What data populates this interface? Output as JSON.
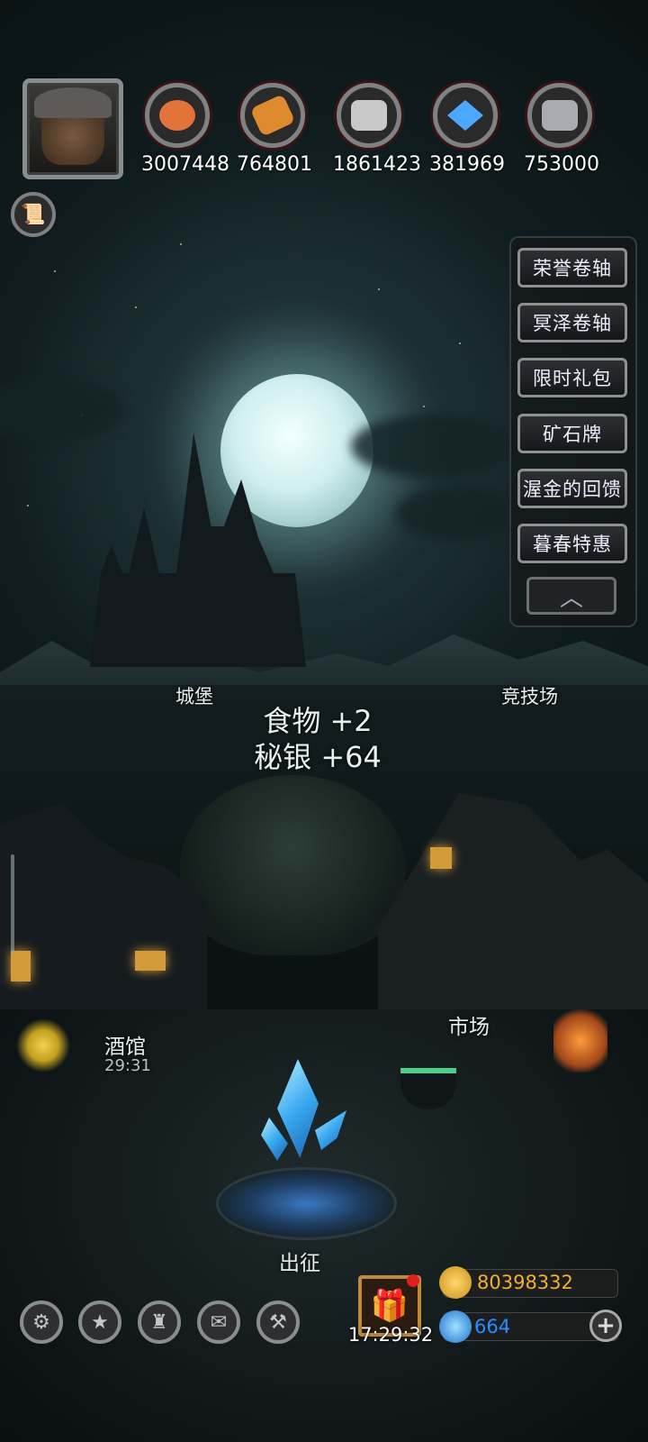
{
  "resources": [
    {
      "icon": "meat-icon",
      "value": "3007448",
      "color": "#e2733a"
    },
    {
      "icon": "wood-planks-icon",
      "value": "764801",
      "color": "#e08a30"
    },
    {
      "icon": "stone-bricks-icon",
      "value": "1861423",
      "color": "#c8c8c8"
    },
    {
      "icon": "crystal-icon",
      "value": "381969",
      "color": "#4aa8ff"
    },
    {
      "icon": "iron-ingots-icon",
      "value": "753000",
      "color": "#a8acb0"
    }
  ],
  "side_menu": [
    "荣誉卷轴",
    "冥泽卷轴",
    "限时礼包",
    "矿石牌",
    "渥金的回馈",
    "暮春特惠"
  ],
  "locations": {
    "castle": "城堡",
    "arena": "竞技场",
    "tavern": "酒馆",
    "tavern_timer": "29:31",
    "market": "市场",
    "expedition": "出征"
  },
  "floating": {
    "food": "食物 +2",
    "mithril": "秘银 +64"
  },
  "bottom_icons": [
    "settings-gear-icon",
    "achievement-star-icon",
    "castle-tower-icon",
    "mail-envelope-icon",
    "handshake-alliance-icon"
  ],
  "gift": {
    "timer": "17:29:32"
  },
  "currency": {
    "gold": "80398332",
    "gems": "664"
  },
  "colors": {
    "gold_text": "#f0b030",
    "gem_text": "#2a90ff",
    "frame": "#8a8d90"
  }
}
